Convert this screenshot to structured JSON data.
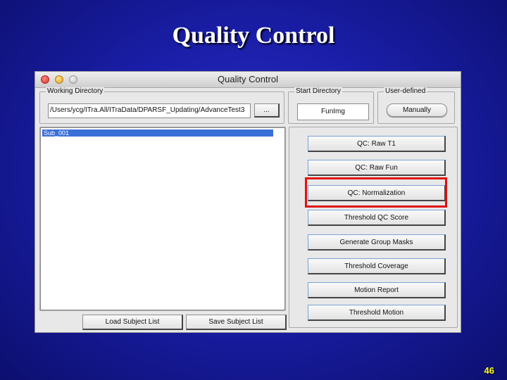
{
  "slide": {
    "title": "Quality Control",
    "page_number": "46"
  },
  "window": {
    "title": "Quality Control",
    "working_directory": {
      "legend": "Working Directory",
      "path_value": "/Users/ycg/ITra.All/ITraData/DPARSF_Updating/AdvanceTest3",
      "browse_label": "..."
    },
    "start_directory": {
      "legend": "Start Directory",
      "value": "FunImg"
    },
    "user_defined": {
      "legend": "User-defined",
      "button_label": "Manually"
    },
    "subject_list": {
      "items": [
        "Sub_001"
      ]
    },
    "load_button": "Load Subject List",
    "save_button": "Save Subject List",
    "qc_buttons": [
      "QC: Raw T1",
      "QC: Raw Fun",
      "QC: Normalization",
      "Threshold QC Score",
      "Generate Group Masks",
      "Threshold Coverage",
      "Motion Report",
      "Threshold Motion"
    ]
  },
  "colors": {
    "highlight": "#e01010",
    "selection": "#3a6fd8"
  }
}
